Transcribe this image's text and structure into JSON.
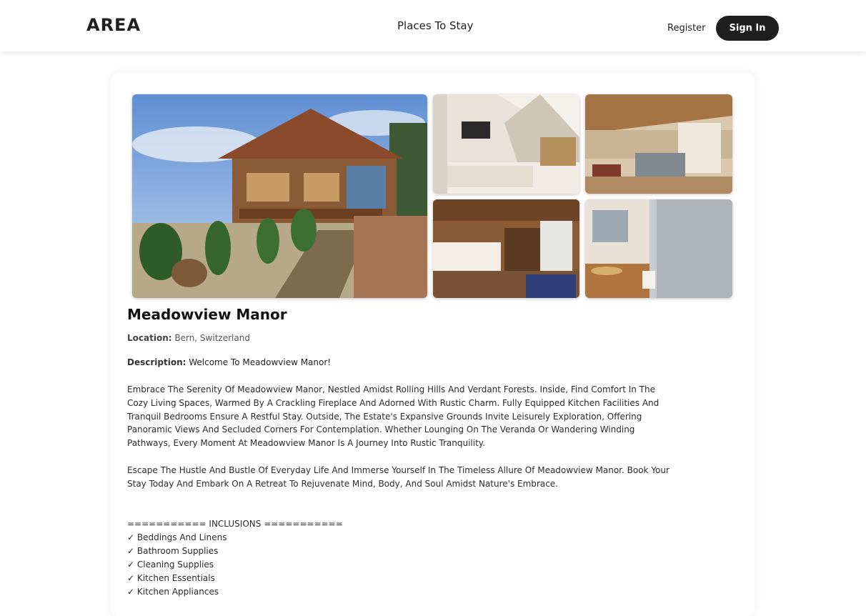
{
  "nav": {
    "logo": "AREA",
    "center_link": "Places To Stay",
    "register": "Register",
    "sign_in": "Sign In"
  },
  "listing": {
    "title": "Meadowview Manor",
    "location_label": "Location:",
    "location_value": " Bern, Switzerland",
    "description_label": "Description:",
    "description_intro": " Welcome To Meadowview Manor!",
    "paragraph_1": "Embrace The Serenity Of Meadowview Manor, Nestled Amidst Rolling Hills And Verdant Forests. Inside, Find Comfort In The Cozy Living Spaces, Warmed By A Crackling Fireplace And Adorned With Rustic Charm. Fully Equipped Kitchen Facilities And Tranquil Bedrooms Ensure A Restful Stay. Outside, The Estate's Expansive Grounds Invite Leisurely Exploration, Offering Panoramic Views And Secluded Corners For Contemplation. Whether Lounging On The Veranda Or Wandering Winding Pathways, Every Moment At Meadowview Manor Is A Journey Into Rustic Tranquility.",
    "paragraph_2": "Escape The Hustle And Bustle Of Everyday Life And Immerse Yourself In The Timeless Allure Of Meadowview Manor. Book Your Stay Today And Embark On A Retreat To Rejuvenate Mind, Body, And Soul Amidst Nature's Embrace.",
    "inclusions_header": "=========== INCLUSIONS ===========",
    "inclusions": [
      "✓ Beddings And Linens",
      "✓ Bathroom Supplies",
      "✓ Cleaning Supplies",
      "✓ Kitchen Essentials",
      "✓ Kitchen Appliances"
    ]
  },
  "colors": {
    "signin_bg": "#1e1e1e",
    "text": "#2b2b2b"
  }
}
